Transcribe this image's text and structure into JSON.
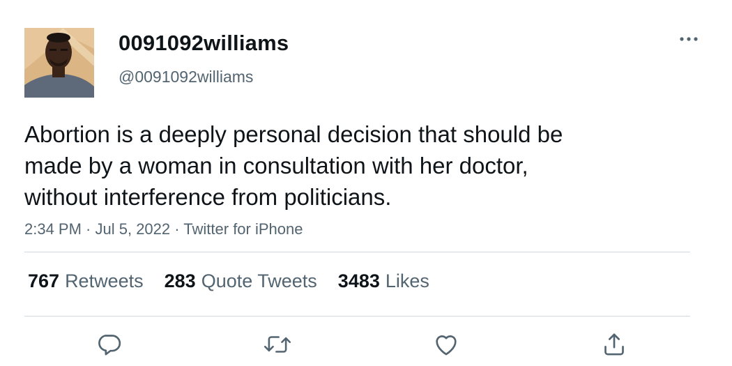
{
  "user": {
    "display_name": "0091092williams",
    "handle": "@0091092williams",
    "avatar_icon": "profile-photo"
  },
  "tweet": {
    "lines": [
      "Abortion is a deeply personal decision that should be",
      "made by a woman in consultation with her doctor,",
      "without interference from politicians."
    ]
  },
  "meta": {
    "time": "2:34 PM",
    "separator": " · ",
    "date": "Jul 5, 2022",
    "source": "Twitter for iPhone"
  },
  "stats": {
    "retweets": {
      "count": "767",
      "label": "Retweets"
    },
    "quotes": {
      "count": "283",
      "label": "Quote Tweets"
    },
    "likes": {
      "count": "3483",
      "label": "Likes"
    }
  },
  "actions": {
    "reply_icon": "reply-icon",
    "retweet_icon": "retweet-icon",
    "like_icon": "heart-icon",
    "share_icon": "share-icon"
  },
  "colors": {
    "text_primary": "#0f1419",
    "text_secondary": "#536471",
    "divider": "#cfd9de"
  }
}
